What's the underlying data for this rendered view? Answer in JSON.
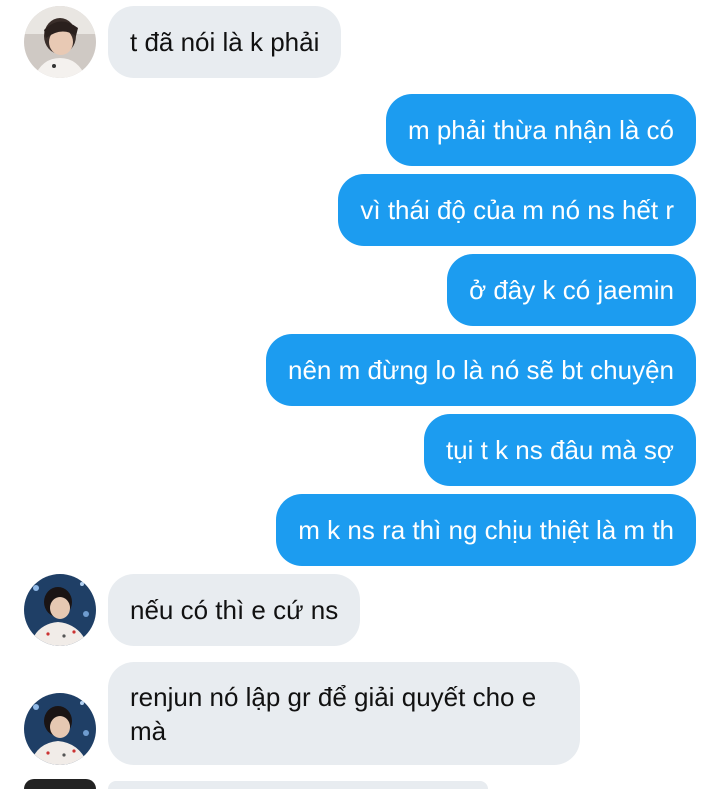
{
  "messages": [
    {
      "text": "t đã nói là k phải",
      "side": "received"
    },
    {
      "text": "m phải thừa nhận là có",
      "side": "sent"
    },
    {
      "text": "vì thái độ của m nó ns hết r",
      "side": "sent"
    },
    {
      "text": "ở đây k có jaemin",
      "side": "sent"
    },
    {
      "text": "nên m đừng lo là nó sẽ bt chuyện",
      "side": "sent"
    },
    {
      "text": "tụi t k ns đâu mà sợ",
      "side": "sent"
    },
    {
      "text": "m k ns ra thì ng chịu thiệt là m th",
      "side": "sent"
    },
    {
      "text": "nếu có thì e cứ ns",
      "side": "received"
    },
    {
      "text": "renjun nó lập gr để giải quyết cho e mà",
      "side": "received"
    }
  ],
  "colors": {
    "sent_bubble": "#1c9cf0",
    "received_bubble": "#e8ecf0",
    "background": "#ffffff"
  },
  "icons": {
    "avatar": "contact-avatar-photo"
  }
}
